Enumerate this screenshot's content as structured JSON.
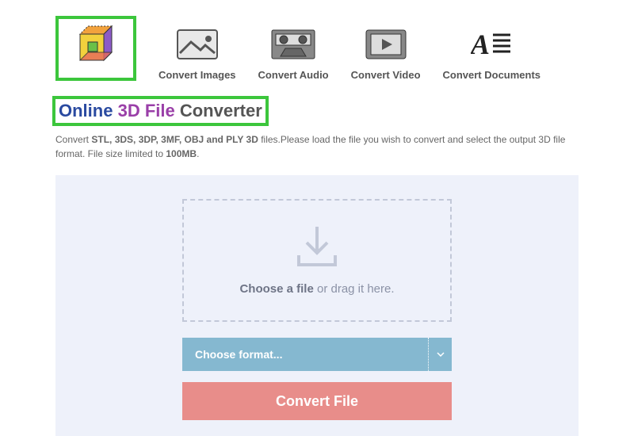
{
  "nav": {
    "items": [
      {
        "label": "Convert Images"
      },
      {
        "label": "Convert Audio"
      },
      {
        "label": "Convert Video"
      },
      {
        "label": "Convert Documents"
      }
    ]
  },
  "title": {
    "part1": "Online",
    "part2": "3D File",
    "part3": "Converter"
  },
  "desc": {
    "pre": "Convert ",
    "formats": "STL, 3DS, 3DP, 3MF, OBJ and PLY 3D",
    "mid": " files.Please load the file you wish to convert and select the output 3D file format. File size limited to ",
    "limit": "100MB",
    "post": "."
  },
  "dropzone": {
    "bold": "Choose a file",
    "rest": " or drag it here."
  },
  "format_select": {
    "label": "Choose format..."
  },
  "convert_button": {
    "label": "Convert File"
  }
}
